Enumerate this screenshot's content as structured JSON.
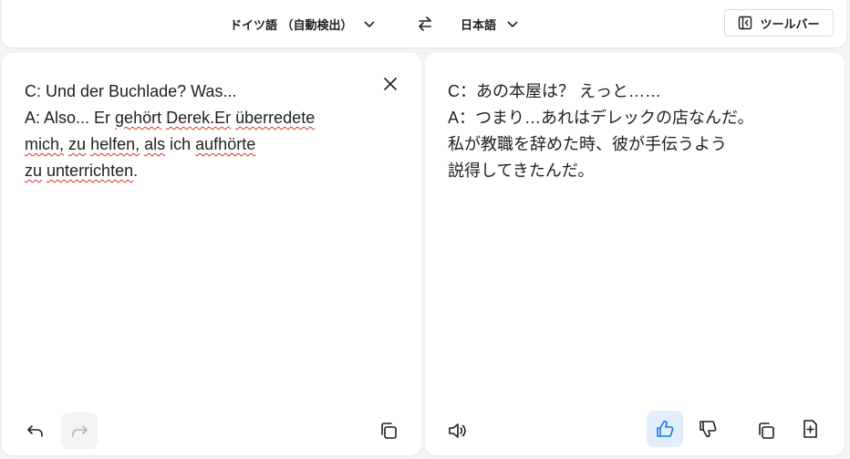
{
  "header": {
    "source_language": "ドイツ語 （自動検出）",
    "target_language": "日本語",
    "toolbar_label": "ツールバー"
  },
  "source": {
    "lines": [
      [
        "C: Und der Buchlade? Was..."
      ],
      [
        "A: Also... Er ",
        {
          "w": "gehört"
        },
        " ",
        {
          "w": "Derek.Er"
        },
        " ",
        {
          "w": "überredete"
        }
      ],
      [
        {
          "w": "mich,"
        },
        " ",
        {
          "w": "zu"
        },
        " ",
        {
          "w": "helfen,"
        },
        " ",
        {
          "w": "als"
        },
        " ich ",
        {
          "w": "aufhörte"
        }
      ],
      [
        {
          "w": "zu"
        },
        " ",
        {
          "w": "unterrichten"
        },
        "."
      ]
    ]
  },
  "target": {
    "lines": [
      "C：あの本屋は？ えっと……",
      "A：つまり…あれはデレックの店なんだ。",
      "私が教職を辞めた時、彼が手伝うよう",
      "説得してきたんだ。"
    ]
  },
  "icons": {
    "source_actions": [
      "undo-icon",
      "redo-icon",
      "copy-icon"
    ],
    "target_actions": [
      "speaker-icon",
      "thumbs-up-icon",
      "thumbs-down-icon",
      "copy-icon",
      "add-note-icon"
    ]
  },
  "colors": {
    "accent": "#1a73e8",
    "active_bg": "#e3eefc",
    "spell_underline": "#d93025"
  }
}
